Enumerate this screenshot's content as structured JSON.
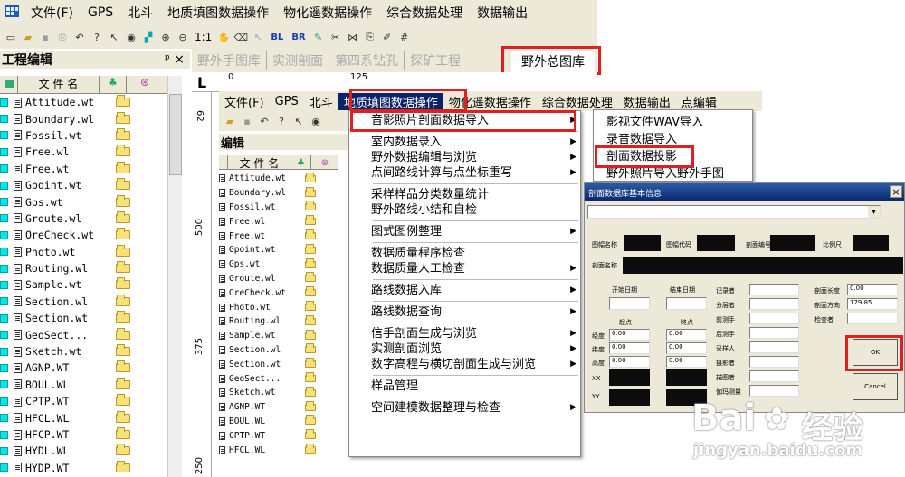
{
  "app_icon": "grid-app-icon",
  "main_menu": [
    "文件(F)",
    "GPS",
    "北斗",
    "地质填图数据操作",
    "物化遥数据操作",
    "综合数据处理",
    "数据输出"
  ],
  "toolbar": {
    "zoom_label": "1:1",
    "bl": "BL",
    "br": "BR"
  },
  "left_panel": {
    "title": "工程编辑",
    "pin": "ᵖ",
    "close": "×",
    "col_name": "文 件 名",
    "files": [
      "Attitude.wt",
      "Boundary.wl",
      "Fossil.wt",
      "Free.wl",
      "Free.wt",
      "Gpoint.wt",
      "Gps.wt",
      "Groute.wl",
      "OreCheck.wt",
      "Photo.wt",
      "Routing.wl",
      "Sample.wt",
      "Section.wl",
      "Section.wt",
      "GeoSect...",
      "Sketch.wt",
      "AGNP.WT",
      "BOUL.WL",
      "CPTP.WT",
      "HFCL.WL",
      "HFCP.WT",
      "HYDL.WL",
      "HYDP.WT"
    ]
  },
  "tabs": [
    "野外手图库",
    "实测剖面",
    "第四系钻孔",
    "探矿工程",
    "野外总图库"
  ],
  "ruler": {
    "l": "L",
    "zero": "0",
    "n125": "125",
    "n62": "62",
    "n500": "500",
    "n375": "375",
    "n250": "250"
  },
  "inner_menu": [
    "文件(F)",
    "GPS",
    "北斗",
    "地质填图数据操作",
    "物化遥数据操作",
    "综合数据处理",
    "数据输出",
    "点编辑"
  ],
  "inner_panel": {
    "title": "编辑",
    "col_name": "文 件 名",
    "files": [
      "Attitude.wt",
      "Boundary.wl",
      "Fossil.wt",
      "Free.wl",
      "Free.wt",
      "Gpoint.wt",
      "Gps.wt",
      "Groute.wl",
      "OreCheck.wt",
      "Photo.wt",
      "Routing.wl",
      "Sample.wt",
      "Section.wl",
      "Section.wt",
      "GeoSect...",
      "Sketch.wt",
      "AGNP.WT",
      "BOUL.WL",
      "CPTP.WT",
      "HFCL.WL"
    ]
  },
  "dropdown": [
    {
      "label": "音影照片剖面数据导入",
      "arrow": true
    },
    {
      "sep": true
    },
    {
      "label": "室内数据录入",
      "arrow": true
    },
    {
      "label": "野外数据编辑与浏览",
      "arrow": true
    },
    {
      "label": "点间路线计算与点坐标重写",
      "arrow": true
    },
    {
      "sep": true
    },
    {
      "label": "采样样品分类数量统计",
      "arrow": false
    },
    {
      "label": "野外路线小结和自检",
      "arrow": false
    },
    {
      "sep": true
    },
    {
      "label": "图式图例整理",
      "arrow": true
    },
    {
      "sep": true
    },
    {
      "label": "数据质量程序检查",
      "arrow": false
    },
    {
      "label": "数据质量人工检查",
      "arrow": true
    },
    {
      "sep": true
    },
    {
      "label": "路线数据入库",
      "arrow": true
    },
    {
      "sep": true
    },
    {
      "label": "路线数据查询",
      "arrow": true
    },
    {
      "sep": true
    },
    {
      "label": "信手剖面生成与浏览",
      "arrow": true
    },
    {
      "label": "实测剖面浏览",
      "arrow": true
    },
    {
      "label": "数字高程与横切剖面生成与浏览",
      "arrow": true
    },
    {
      "sep": true
    },
    {
      "label": "样品管理",
      "arrow": false
    },
    {
      "sep": true
    },
    {
      "label": "空间建模数据整理与检查",
      "arrow": true
    }
  ],
  "submenu": [
    "影视文件WAV导入",
    "录音数据导入",
    "剖面数据投影",
    "野外照片导入野外手图"
  ],
  "dialog": {
    "title": "剖面数据库基本信息",
    "close": "×",
    "labels": {
      "map_name": "图幅名称",
      "map_code": "图幅代码",
      "section_no": "剖面编号",
      "scale": "比例尺",
      "section_name": "剖面名称",
      "start_date": "开始日期",
      "end_date": "结束日期",
      "recorder": "记录者",
      "layer": "分层者",
      "front_survey": "前测手",
      "back_survey": "后测手",
      "sampler": "采样人",
      "photographer": "摄影者",
      "drafter": "描图者",
      "gps_survey": "伽玛测量",
      "length": "剖面长度",
      "direction": "剖面方向",
      "checker": "检查者",
      "start_pt": "起点",
      "end_pt": "终点",
      "lon": "经度",
      "lat": "纬度",
      "elev": "高度",
      "xx": "XX",
      "yy": "YY"
    },
    "values": {
      "length": "0.00",
      "direction": "179.85",
      "zero": "0.00"
    },
    "ok": "OK",
    "cancel": "Cancel"
  },
  "watermark": {
    "brand": "Bai",
    "cn": "经验",
    "url": "jingyan.baidu.com"
  },
  "colors": {
    "highlight": "#e02020",
    "menu_select": "#0a246a",
    "chrome": "#ece9d8"
  }
}
